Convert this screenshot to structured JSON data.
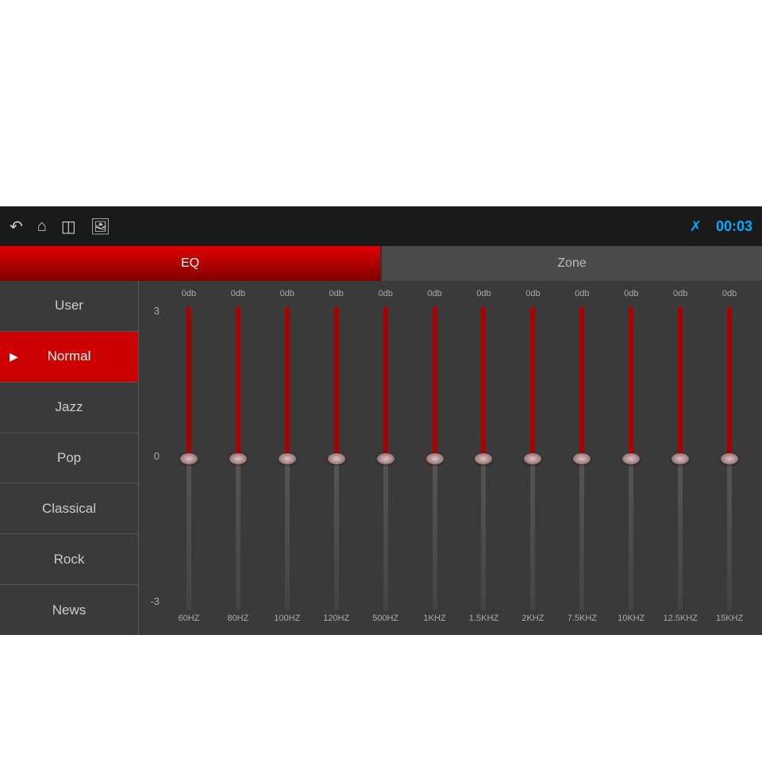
{
  "topbar": {
    "time": "00:03",
    "icons": [
      "back",
      "home",
      "window",
      "image"
    ]
  },
  "tabs": [
    {
      "label": "EQ",
      "active": true
    },
    {
      "label": "Zone",
      "active": false
    }
  ],
  "sidebar": {
    "items": [
      {
        "label": "User",
        "active": false
      },
      {
        "label": "Normal",
        "active": true
      },
      {
        "label": "Jazz",
        "active": false
      },
      {
        "label": "Pop",
        "active": false
      },
      {
        "label": "Classical",
        "active": false
      },
      {
        "label": "Rock",
        "active": false
      },
      {
        "label": "News",
        "active": false
      }
    ]
  },
  "eq": {
    "scale": {
      "top": "3",
      "mid": "0",
      "bot": "-3"
    },
    "bands": [
      {
        "freq": "60HZ",
        "db": "0db"
      },
      {
        "freq": "80HZ",
        "db": "0db"
      },
      {
        "freq": "100HZ",
        "db": "0db"
      },
      {
        "freq": "120HZ",
        "db": "0db"
      },
      {
        "freq": "500HZ",
        "db": "0db"
      },
      {
        "freq": "1KHZ",
        "db": "0db"
      },
      {
        "freq": "1.5KHZ",
        "db": "0db"
      },
      {
        "freq": "2KHZ",
        "db": "0db"
      },
      {
        "freq": "7.5KHZ",
        "db": "0db"
      },
      {
        "freq": "10KHZ",
        "db": "0db"
      },
      {
        "freq": "12.5KHZ",
        "db": "0db"
      },
      {
        "freq": "15KHZ",
        "db": "0db"
      }
    ]
  }
}
